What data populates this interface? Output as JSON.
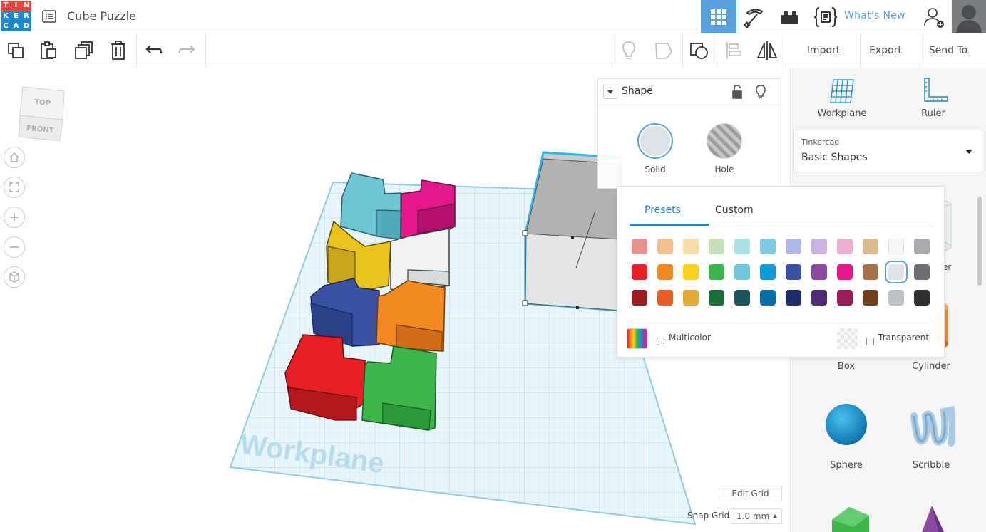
{
  "app": {
    "logo_letters": [
      "T",
      "I",
      "N",
      "K",
      "E",
      "R",
      "C",
      "A",
      "D"
    ],
    "logo_colors": [
      "#e8453c",
      "#e8453c",
      "#e8453c",
      "#1f8ac9",
      "#1f8ac9",
      "#1f8ac9",
      "#1f8ac9",
      "#1f8ac9",
      "#1f8ac9"
    ],
    "title": "Cube Puzzle",
    "accent": "#5aa0db"
  },
  "topbar": {
    "icons": [
      "grid-view-icon",
      "pickaxe-icon",
      "brick-icon",
      "codeblocks-icon"
    ],
    "whats_new": "What's New",
    "add_user_icon": "add-user-icon",
    "avatar_icon": "avatar-icon"
  },
  "toolbar": {
    "left_icons": [
      "copy-icon",
      "paste-icon",
      "duplicate-icon",
      "delete-icon",
      "undo-icon",
      "redo-icon"
    ],
    "right_icons": [
      "lightbulb-icon",
      "shape-outline-icon",
      "group-icon",
      "align-icon",
      "mirror-icon"
    ],
    "import": "Import",
    "export": "Export",
    "send_to": "Send To"
  },
  "viewcube": {
    "top": "TOP",
    "front": "FRONT"
  },
  "nav_icons": [
    "home-icon",
    "fit-view-icon",
    "zoom-in-icon",
    "zoom-out-icon",
    "perspective-icon"
  ],
  "workplane_label": "Workplane",
  "shape_panel": {
    "title": "Shape",
    "solid": "Solid",
    "hole": "Hole"
  },
  "color_popup": {
    "tabs": [
      "Presets",
      "Custom"
    ],
    "active_tab": "Presets",
    "row1": [
      "#e8908a",
      "#f5c08f",
      "#f6dfa6",
      "#c5e0b7",
      "#a8e2e7",
      "#7ccbe6",
      "#acb8e8",
      "#ccb3e4",
      "#eeadd3",
      "#ddb98c",
      "#f7f7f7",
      "#a8aaad"
    ],
    "row2": [
      "#e81f25",
      "#f28a21",
      "#f7d21b",
      "#3cb54a",
      "#72c6da",
      "#0d9bd7",
      "#3a52a3",
      "#8b4aa1",
      "#e3168a",
      "#a47247",
      "#dfe3e7",
      "#6d6e71"
    ],
    "row3": [
      "#9b1d22",
      "#e75f22",
      "#e3aa37",
      "#1a6e3a",
      "#1f545c",
      "#0b6da6",
      "#1d2f68",
      "#4f2a79",
      "#9a1c55",
      "#70401c",
      "#bfc2c4",
      "#2f3133"
    ],
    "selected_index": [
      1,
      10
    ],
    "multicolor": "Multicolor",
    "transparent": "Transparent"
  },
  "library": {
    "workplane": "Workplane",
    "ruler": "Ruler",
    "source_label": "Tinkercad",
    "category": "Basic Shapes",
    "items": [
      "Box",
      "Cylinder",
      "Sphere",
      "Scribble"
    ],
    "hidden_label_partial": "er"
  },
  "grid": {
    "edit_grid": "Edit Grid",
    "snap_grid": "Snap Grid",
    "snap_value": "1.0 mm"
  }
}
